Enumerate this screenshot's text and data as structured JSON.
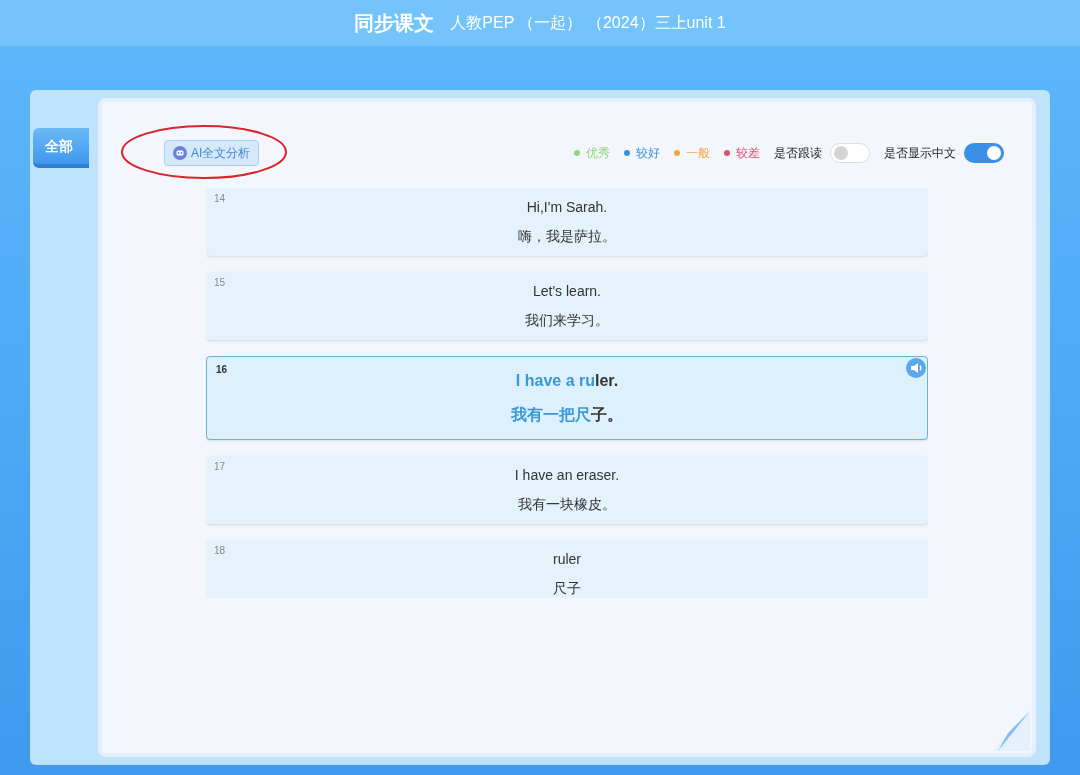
{
  "header": {
    "title": "同步课文",
    "subtitle": "人教PEP （一起） （2024）三上unit 1"
  },
  "sidebar": {
    "tabs": [
      {
        "label": "全部",
        "selected": true
      }
    ]
  },
  "ai_button": {
    "label": "AI全文分析"
  },
  "legend": [
    {
      "label": "优秀",
      "color": "#8fd67a"
    },
    {
      "label": "较好",
      "color": "#3d8fd6"
    },
    {
      "label": "一般",
      "color": "#f0a640"
    },
    {
      "label": "较差",
      "color": "#e0506a"
    }
  ],
  "toggles": [
    {
      "label": "是否跟读",
      "on": false
    },
    {
      "label": "是否显示中文",
      "on": true
    }
  ],
  "sentences": [
    {
      "number": "14",
      "en": "Hi,I'm Sarah.",
      "zh": "嗨，我是萨拉。",
      "selected": false
    },
    {
      "number": "15",
      "en": "Let's learn.",
      "zh": "我们来学习。",
      "selected": false
    },
    {
      "number": "16",
      "en_read": "I have a ru",
      "en": "ler.",
      "zh_read": "我有一把尺",
      "zh": "子。",
      "selected": true
    },
    {
      "number": "17",
      "en": "I have an eraser.",
      "zh": "我有一块橡皮。",
      "selected": false
    },
    {
      "number": "18",
      "en": "ruler",
      "zh": "尺子",
      "selected": false
    }
  ]
}
